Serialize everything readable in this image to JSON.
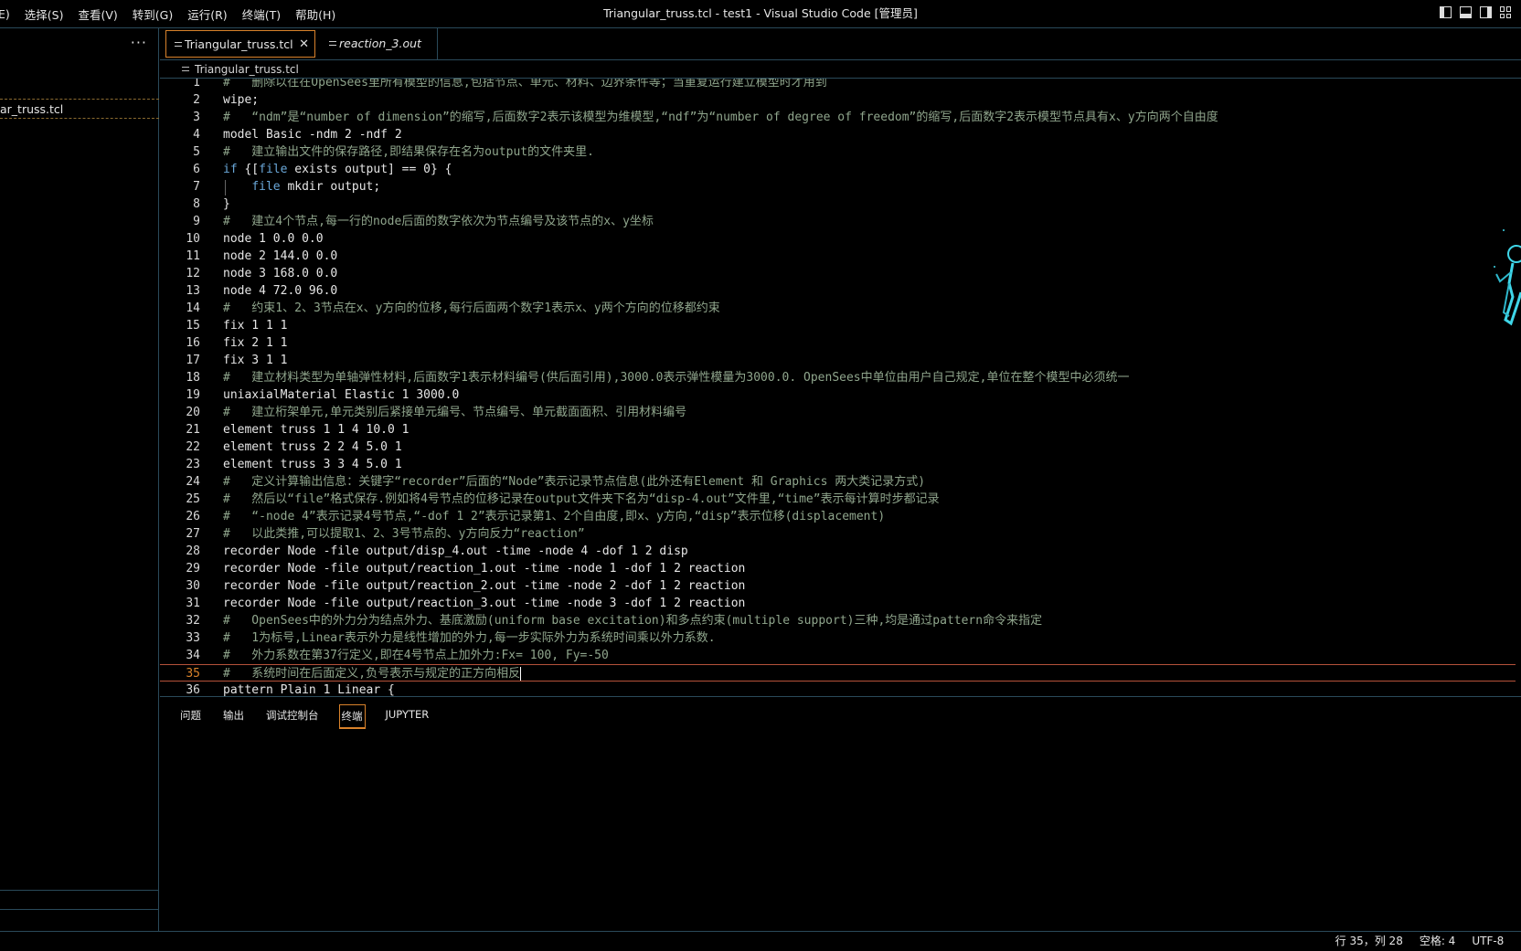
{
  "window": {
    "title": "Triangular_truss.tcl - test1 - Visual Studio Code [管理员]"
  },
  "menu": [
    "E)",
    "选择(S)",
    "查看(V)",
    "转到(G)",
    "运行(R)",
    "终端(T)",
    "帮助(H)"
  ],
  "sidebar": {
    "more_label": "···",
    "file_label": "ar_truss.tcl"
  },
  "tabs": [
    {
      "label": "Triangular_truss.tcl",
      "close": "✕"
    },
    {
      "label": "reaction_3.out"
    }
  ],
  "breadcrumb": "Triangular_truss.tcl",
  "editor": {
    "lines": [
      {
        "n": "1",
        "text": "#   删除以往在OpenSees里所有模型的信息,包括节点、单元、材料、边界条件等；当重复运行建立模型时才用到"
      },
      {
        "n": "2",
        "text": "wipe;"
      },
      {
        "n": "3",
        "text": "#   “ndm”是“number of dimension”的缩写,后面数字2表示该模型为维模型,“ndf”为“number of degree of freedom”的缩写,后面数字2表示模型节点具有x、y方向两个自由度"
      },
      {
        "n": "4",
        "text": "model Basic -ndm 2 -ndf 2"
      },
      {
        "n": "5",
        "text": "#   建立输出文件的保存路径,即结果保存在名为output的文件夹里."
      },
      {
        "n": "6",
        "text": "if {[file exists output] == 0} {"
      },
      {
        "n": "7",
        "text": "    file mkdir output;"
      },
      {
        "n": "8",
        "text": "}"
      },
      {
        "n": "9",
        "text": "#   建立4个节点,每一行的node后面的数字依次为节点编号及该节点的x、y坐标"
      },
      {
        "n": "10",
        "text": "node 1 0.0 0.0"
      },
      {
        "n": "11",
        "text": "node 2 144.0 0.0"
      },
      {
        "n": "12",
        "text": "node 3 168.0 0.0"
      },
      {
        "n": "13",
        "text": "node 4 72.0 96.0"
      },
      {
        "n": "14",
        "text": "#   约束1、2、3节点在x、y方向的位移,每行后面两个数字1表示x、y两个方向的位移都约束"
      },
      {
        "n": "15",
        "text": "fix 1 1 1"
      },
      {
        "n": "16",
        "text": "fix 2 1 1"
      },
      {
        "n": "17",
        "text": "fix 3 1 1"
      },
      {
        "n": "18",
        "text": "#   建立材料类型为单轴弹性材料,后面数字1表示材料编号(供后面引用),3000.0表示弹性模量为3000.0. OpenSees中单位由用户自己规定,单位在整个模型中必须统一"
      },
      {
        "n": "19",
        "text": "uniaxialMaterial Elastic 1 3000.0"
      },
      {
        "n": "20",
        "text": "#   建立桁架单元,单元类别后紧接单元编号、节点编号、单元截面面积、引用材料编号"
      },
      {
        "n": "21",
        "text": "element truss 1 1 4 10.0 1"
      },
      {
        "n": "22",
        "text": "element truss 2 2 4 5.0 1"
      },
      {
        "n": "23",
        "text": "element truss 3 3 4 5.0 1"
      },
      {
        "n": "24",
        "text": "#   定义计算输出信息：关键字“recorder”后面的“Node”表示记录节点信息(此外还有Element 和 Graphics 两大类记录方式)"
      },
      {
        "n": "25",
        "text": "#   然后以“file”格式保存.例如将4号节点的位移记录在output文件夹下名为“disp-4.out”文件里,“time”表示每计算时步都记录"
      },
      {
        "n": "26",
        "text": "#   “-node 4”表示记录4号节点,“-dof 1 2”表示记录第1、2个自由度,即x、y方向,“disp”表示位移(displacement)"
      },
      {
        "n": "27",
        "text": "#   以此类推,可以提取1、2、3号节点的、y方向反力“reaction”"
      },
      {
        "n": "28",
        "text": "recorder Node -file output/disp_4.out -time -node 4 -dof 1 2 disp"
      },
      {
        "n": "29",
        "text": "recorder Node -file output/reaction_1.out -time -node 1 -dof 1 2 reaction"
      },
      {
        "n": "30",
        "text": "recorder Node -file output/reaction_2.out -time -node 2 -dof 1 2 reaction"
      },
      {
        "n": "31",
        "text": "recorder Node -file output/reaction_3.out -time -node 3 -dof 1 2 reaction"
      },
      {
        "n": "32",
        "text": "#   OpenSees中的外力分为结点外力、基底激励(uniform base excitation)和多点约束(multiple support)三种,均是通过pattern命令来指定"
      },
      {
        "n": "33",
        "text": "#   1为标号,Linear表示外力是线性增加的外力,每一步实际外力为系统时间乘以外力系数."
      },
      {
        "n": "34",
        "text": "#   外力系数在第37行定义,即在4号节点上加外力:Fx= 100, Fy=-50"
      },
      {
        "n": "35",
        "text": "#   系统时间在后面定义,负号表示与规定的正方向相反"
      },
      {
        "n": "36",
        "text": "pattern Plain 1 Linear {"
      }
    ]
  },
  "panel": {
    "tabs": [
      "问题",
      "输出",
      "调试控制台",
      "终端",
      "JUPYTER"
    ],
    "active": "终端"
  },
  "status": {
    "position": "行 35，列 28",
    "spaces": "空格: 4",
    "encoding": "UTF-8",
    "extra": "("
  },
  "colors": {
    "accent": "#d9822b",
    "border": "#2a4a5a",
    "comment": "#8fa58c",
    "keyword": "#6aa7d8"
  }
}
